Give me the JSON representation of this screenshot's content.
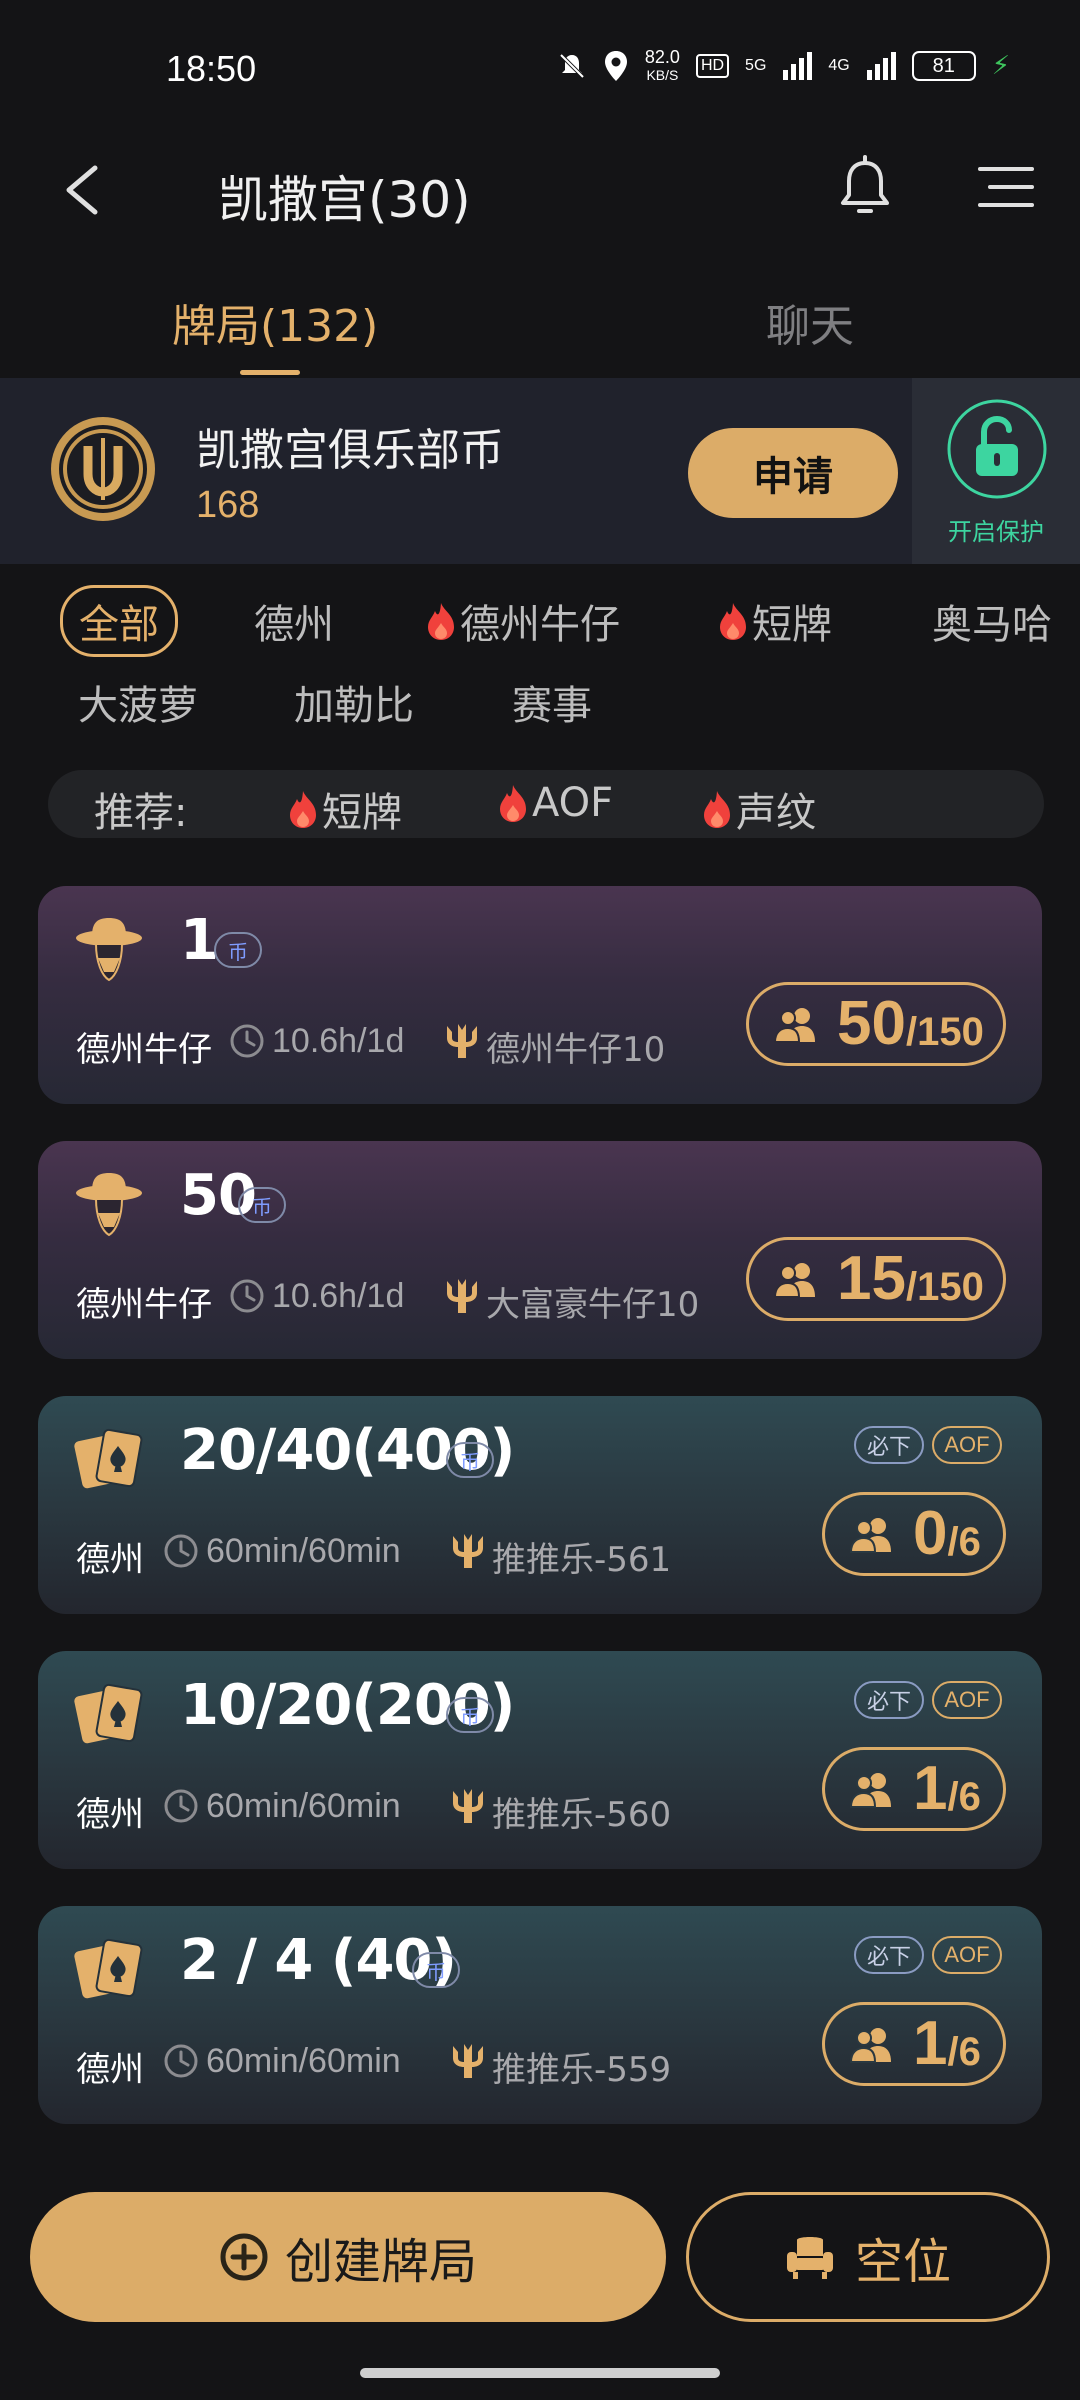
{
  "status_bar": {
    "time": "18:50",
    "net_speed_value": "82.0",
    "net_speed_unit": "KB/S",
    "hd": "HD",
    "network_5g": "5G",
    "network_4g": "4G",
    "battery": "81",
    "icons": [
      "mute-icon",
      "location-icon",
      "signal-icon",
      "signal-icon",
      "charging-icon"
    ]
  },
  "header": {
    "title": "凯撒宫(30)",
    "icons": [
      "back-icon",
      "bell-icon",
      "menu-icon"
    ]
  },
  "tabs": [
    {
      "label": "牌局(132)",
      "active": true
    },
    {
      "label": "聊天",
      "active": false
    }
  ],
  "club_coin": {
    "name": "凯撒宫俱乐部币",
    "amount": "168",
    "apply_label": "申请",
    "protect_label": "开启保护"
  },
  "filters": [
    {
      "label": "全部",
      "active": true,
      "hot": false
    },
    {
      "label": "德州",
      "active": false,
      "hot": false
    },
    {
      "label": "德州牛仔",
      "active": false,
      "hot": true
    },
    {
      "label": "短牌",
      "active": false,
      "hot": true
    },
    {
      "label": "奥马哈",
      "active": false,
      "hot": false
    },
    {
      "label": "大菠萝",
      "active": false,
      "hot": false
    },
    {
      "label": "加勒比",
      "active": false,
      "hot": false
    },
    {
      "label": "赛事",
      "active": false,
      "hot": false
    }
  ],
  "recommend": {
    "label": "推荐:",
    "items": [
      "短牌",
      "AOF",
      "声纹"
    ]
  },
  "coin_tag": "币",
  "tables": [
    {
      "blinds": "1",
      "type": "德州牛仔",
      "time": "10.6h/1d",
      "owner": "德州牛仔10",
      "players": "50",
      "max": "/150",
      "badges": []
    },
    {
      "blinds": "50",
      "type": "德州牛仔",
      "time": "10.6h/1d",
      "owner": "大富豪牛仔10",
      "players": "15",
      "max": "/150",
      "badges": []
    },
    {
      "blinds": "20/40(400)",
      "type": "德州",
      "time": "60min/60min",
      "owner": "推推乐-561",
      "players": "0",
      "max": "/6",
      "badges": [
        "必下",
        "AOF"
      ]
    },
    {
      "blinds": "10/20(200)",
      "type": "德州",
      "time": "60min/60min",
      "owner": "推推乐-560",
      "players": "1",
      "max": "/6",
      "badges": [
        "必下",
        "AOF"
      ]
    },
    {
      "blinds": "2 / 4 (40)",
      "type": "德州",
      "time": "60min/60min",
      "owner": "推推乐-559",
      "players": "1",
      "max": "/6",
      "badges": [
        "必下",
        "AOF"
      ]
    }
  ],
  "bottom": {
    "create_label": "创建牌局",
    "seat_label": "空位"
  },
  "colors": {
    "accent_gold": "#dcac68",
    "background": "#141416",
    "protect_green": "#3dd5a0"
  }
}
